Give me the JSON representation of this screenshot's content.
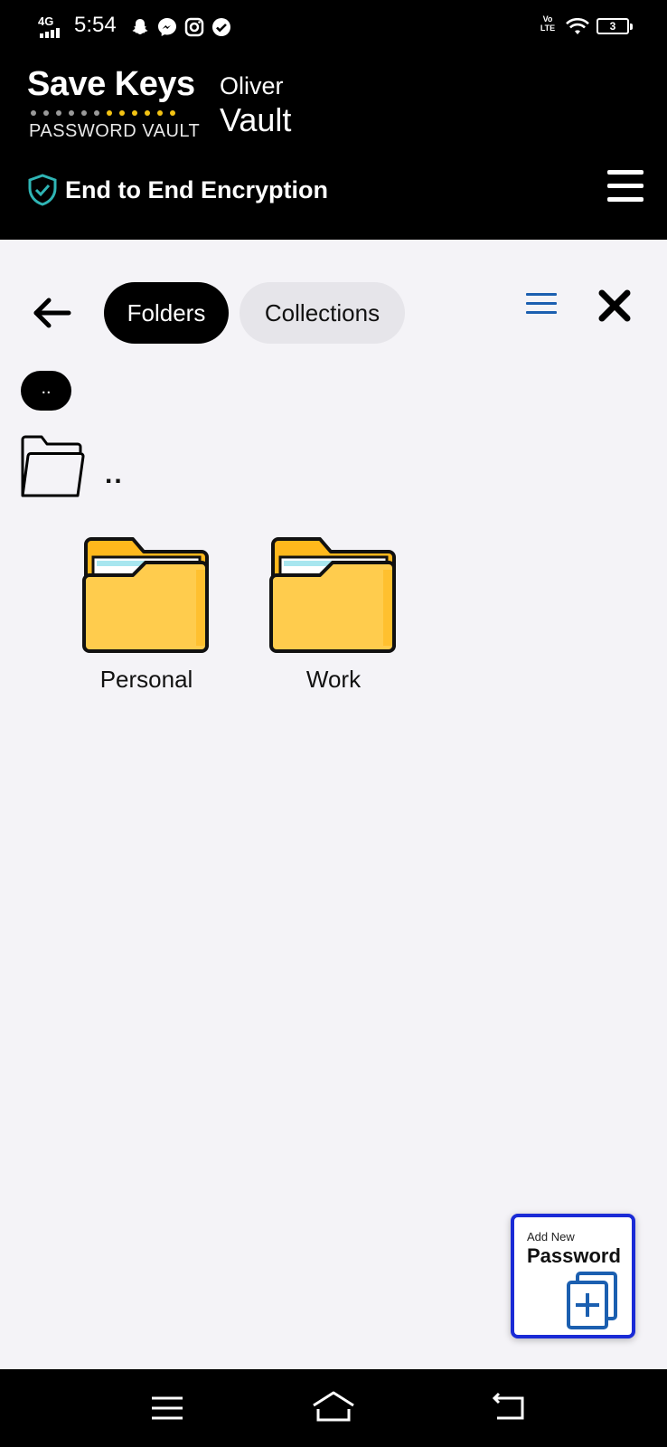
{
  "status_bar": {
    "network": "4G",
    "time": "5:54",
    "volte": "Vo LTE",
    "battery": "3"
  },
  "header": {
    "logo_title": "Save Keys",
    "logo_subtitle": "PASSWORD VAULT",
    "user_name": "Oliver",
    "vault_name": "Vault",
    "encryption_label": "End to End Encryption"
  },
  "toolbar": {
    "tabs": [
      {
        "label": "Folders",
        "active": true
      },
      {
        "label": "Collections",
        "active": false
      }
    ]
  },
  "breadcrumb": {
    "label": ".."
  },
  "parent_folder": {
    "label": ".."
  },
  "folders": [
    {
      "label": "Personal"
    },
    {
      "label": "Work"
    }
  ],
  "fab": {
    "small_label": "Add New",
    "big_label": "Password"
  },
  "colors": {
    "header_bg": "#000000",
    "page_bg": "#f4f3f7",
    "folder_yellow": "#ffcc4d",
    "folder_back": "#ffb81c",
    "accent_blue": "#1a2bd6",
    "shield_teal": "#2fb5b5"
  },
  "icons": {
    "header_menu": "hamburger-icon",
    "back": "arrow-left-icon",
    "list_view": "list-icon",
    "close": "close-icon",
    "shield": "shield-check-icon",
    "fab": "add-copy-icon"
  }
}
